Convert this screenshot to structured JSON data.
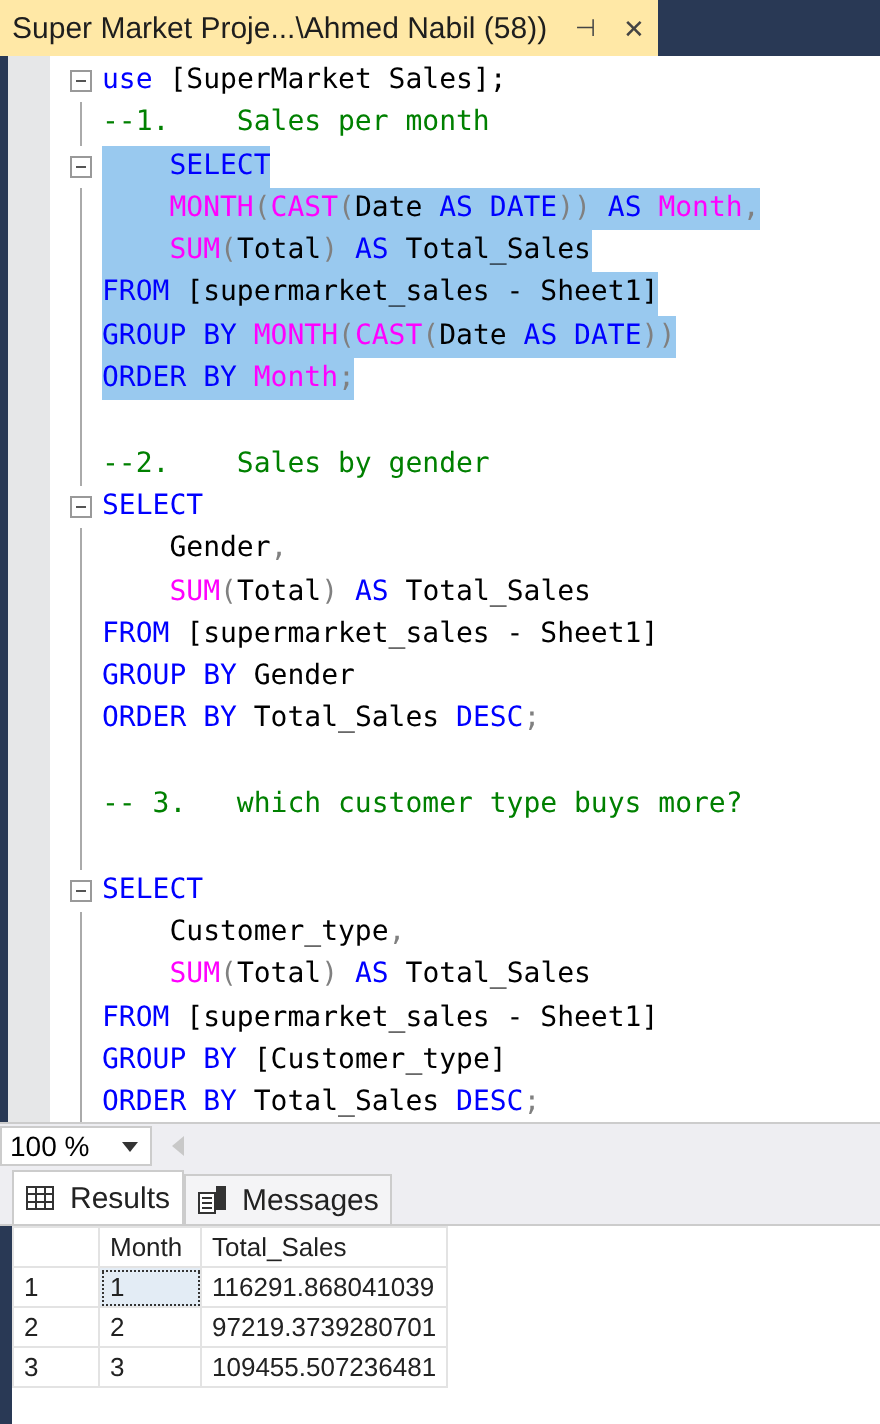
{
  "tab": {
    "title": "Super Market Proje...\\Ahmed Nabil (58))",
    "pin": "⊣",
    "close": "✕"
  },
  "code_lines": [
    {
      "fold": true,
      "selected": false,
      "tokens": [
        {
          "kind": "keyword",
          "t": "use"
        },
        {
          "kind": "plain",
          "t": " [SuperMarket Sales];"
        }
      ]
    },
    {
      "fold": false,
      "selected": false,
      "tokens": [
        {
          "kind": "comment",
          "t": "--1.    Sales per month"
        }
      ]
    },
    {
      "fold": true,
      "selected": true,
      "tokens": [
        {
          "kind": "keyword",
          "t": "    SELECT"
        }
      ]
    },
    {
      "fold": false,
      "selected": true,
      "tokens": [
        {
          "kind": "function",
          "t": "    MONTH"
        },
        {
          "kind": "operator",
          "t": "("
        },
        {
          "kind": "function",
          "t": "CAST"
        },
        {
          "kind": "operator",
          "t": "("
        },
        {
          "kind": "plain",
          "t": "Date "
        },
        {
          "kind": "keyword",
          "t": "AS DATE"
        },
        {
          "kind": "operator",
          "t": "))"
        },
        {
          "kind": "keyword",
          "t": " AS "
        },
        {
          "kind": "function",
          "t": "Month"
        },
        {
          "kind": "operator",
          "t": ","
        }
      ]
    },
    {
      "fold": false,
      "selected": true,
      "tokens": [
        {
          "kind": "function",
          "t": "    SUM"
        },
        {
          "kind": "operator",
          "t": "("
        },
        {
          "kind": "plain",
          "t": "Total"
        },
        {
          "kind": "operator",
          "t": ")"
        },
        {
          "kind": "keyword",
          "t": " AS"
        },
        {
          "kind": "plain",
          "t": " Total_Sales"
        }
      ]
    },
    {
      "fold": false,
      "selected": true,
      "tokens": [
        {
          "kind": "keyword",
          "t": "FROM"
        },
        {
          "kind": "plain",
          "t": " [supermarket_sales - Sheet1]"
        }
      ]
    },
    {
      "fold": false,
      "selected": true,
      "tokens": [
        {
          "kind": "keyword",
          "t": "GROUP BY "
        },
        {
          "kind": "function",
          "t": "MONTH"
        },
        {
          "kind": "operator",
          "t": "("
        },
        {
          "kind": "function",
          "t": "CAST"
        },
        {
          "kind": "operator",
          "t": "("
        },
        {
          "kind": "plain",
          "t": "Date "
        },
        {
          "kind": "keyword",
          "t": "AS DATE"
        },
        {
          "kind": "operator",
          "t": "))"
        }
      ]
    },
    {
      "fold": false,
      "selected": true,
      "tokens": [
        {
          "kind": "keyword",
          "t": "ORDER BY "
        },
        {
          "kind": "function",
          "t": "Month"
        },
        {
          "kind": "operator",
          "t": ";"
        }
      ]
    },
    {
      "fold": false,
      "selected": false
    },
    {
      "fold": false,
      "selected": false,
      "tokens": [
        {
          "kind": "comment",
          "t": "--2.    Sales by gender"
        }
      ]
    },
    {
      "fold": true,
      "selected": false,
      "tokens": [
        {
          "kind": "keyword",
          "t": "SELECT"
        }
      ]
    },
    {
      "fold": false,
      "selected": false,
      "tokens": [
        {
          "kind": "plain",
          "t": "    Gender"
        },
        {
          "kind": "operator",
          "t": ","
        }
      ]
    },
    {
      "fold": false,
      "selected": false,
      "tokens": [
        {
          "kind": "function",
          "t": "    SUM"
        },
        {
          "kind": "operator",
          "t": "("
        },
        {
          "kind": "plain",
          "t": "Total"
        },
        {
          "kind": "operator",
          "t": ")"
        },
        {
          "kind": "keyword",
          "t": " AS"
        },
        {
          "kind": "plain",
          "t": " Total_Sales"
        }
      ]
    },
    {
      "fold": false,
      "selected": false,
      "tokens": [
        {
          "kind": "keyword",
          "t": "FROM"
        },
        {
          "kind": "plain",
          "t": " [supermarket_sales - Sheet1]"
        }
      ]
    },
    {
      "fold": false,
      "selected": false,
      "tokens": [
        {
          "kind": "keyword",
          "t": "GROUP BY"
        },
        {
          "kind": "plain",
          "t": " Gender"
        }
      ]
    },
    {
      "fold": false,
      "selected": false,
      "tokens": [
        {
          "kind": "keyword",
          "t": "ORDER BY"
        },
        {
          "kind": "plain",
          "t": " Total_Sales "
        },
        {
          "kind": "keyword",
          "t": "DESC"
        },
        {
          "kind": "operator",
          "t": ";"
        }
      ]
    },
    {
      "fold": false,
      "selected": false
    },
    {
      "fold": false,
      "selected": false,
      "tokens": [
        {
          "kind": "comment",
          "t": "-- 3.   which customer type buys more?"
        }
      ]
    },
    {
      "fold": false,
      "selected": false
    },
    {
      "fold": true,
      "selected": false,
      "tokens": [
        {
          "kind": "keyword",
          "t": "SELECT"
        }
      ]
    },
    {
      "fold": false,
      "selected": false,
      "tokens": [
        {
          "kind": "plain",
          "t": "    Customer_type"
        },
        {
          "kind": "operator",
          "t": ","
        }
      ]
    },
    {
      "fold": false,
      "selected": false,
      "tokens": [
        {
          "kind": "function",
          "t": "    SUM"
        },
        {
          "kind": "operator",
          "t": "("
        },
        {
          "kind": "plain",
          "t": "Total"
        },
        {
          "kind": "operator",
          "t": ")"
        },
        {
          "kind": "keyword",
          "t": " AS"
        },
        {
          "kind": "plain",
          "t": " Total_Sales"
        }
      ]
    },
    {
      "fold": false,
      "selected": false,
      "tokens": [
        {
          "kind": "keyword",
          "t": "FROM"
        },
        {
          "kind": "plain",
          "t": " [supermarket_sales - Sheet1]"
        }
      ]
    },
    {
      "fold": false,
      "selected": false,
      "tokens": [
        {
          "kind": "keyword",
          "t": "GROUP BY"
        },
        {
          "kind": "plain",
          "t": " [Customer_type]"
        }
      ]
    },
    {
      "fold": false,
      "selected": false,
      "tokens": [
        {
          "kind": "keyword",
          "t": "ORDER BY"
        },
        {
          "kind": "plain",
          "t": " Total_Sales "
        },
        {
          "kind": "keyword",
          "t": "DESC"
        },
        {
          "kind": "operator",
          "t": ";"
        }
      ]
    }
  ],
  "zoom": {
    "value": "100 %"
  },
  "result_tabs": [
    {
      "label": "Results",
      "kind": "grid",
      "selected": true
    },
    {
      "label": "Messages",
      "kind": "messages",
      "selected": false
    }
  ],
  "results": {
    "columns": [
      "Month",
      "Total_Sales"
    ],
    "rows": [
      {
        "number": "1",
        "cells": [
          "1",
          "116291.868041039"
        ],
        "focused": true
      },
      {
        "number": "2",
        "cells": [
          "2",
          "97219.3739280701"
        ],
        "focused": false
      },
      {
        "number": "3",
        "cells": [
          "3",
          "109455.507236481"
        ],
        "focused": false
      }
    ]
  }
}
